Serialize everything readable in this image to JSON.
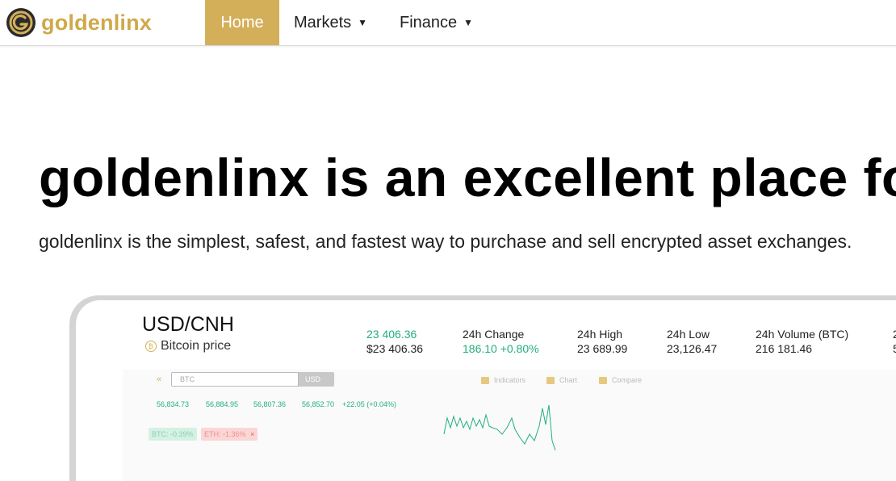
{
  "nav": {
    "brand": "goldenlinx",
    "home": "Home",
    "markets": "Markets",
    "finance": "Finance"
  },
  "hero": {
    "title": "goldenlinx is an excellent place for",
    "subtitle": "goldenlinx is the simplest, safest, and fastest way to purchase and sell encrypted asset exchanges."
  },
  "ticker": {
    "pair": "USD/CNH",
    "coin_label": "Bitcoin price",
    "price": "23 406.36",
    "price_usd": "$23 406.36",
    "change_label": "24h Change",
    "change_value": "186.10 +0.80%",
    "high_label": "24h High",
    "high_value": "23 689.99",
    "low_label": "24h Low",
    "low_value": "23,126.47",
    "volume_label": "24h Volume (BTC)",
    "volume_value": "216 181.46",
    "cut_label": "2",
    "cut_value": "5"
  },
  "panel": {
    "back": "«",
    "search_value": "BTC",
    "currency": "USD",
    "tools": [
      "Indicators",
      "Chart",
      "Compare"
    ],
    "ticks": [
      "56,834.73",
      "56,884.95",
      "56,807.36",
      "56,852.70",
      "+22.05 (+0.04%)"
    ],
    "chip_btc": "BTC: -0.39%",
    "chip_eth": "ETH: -1.36%",
    "chip_close": "×"
  },
  "colors": {
    "brand_gold": "#d4af5a",
    "up_green": "#21b07a"
  }
}
